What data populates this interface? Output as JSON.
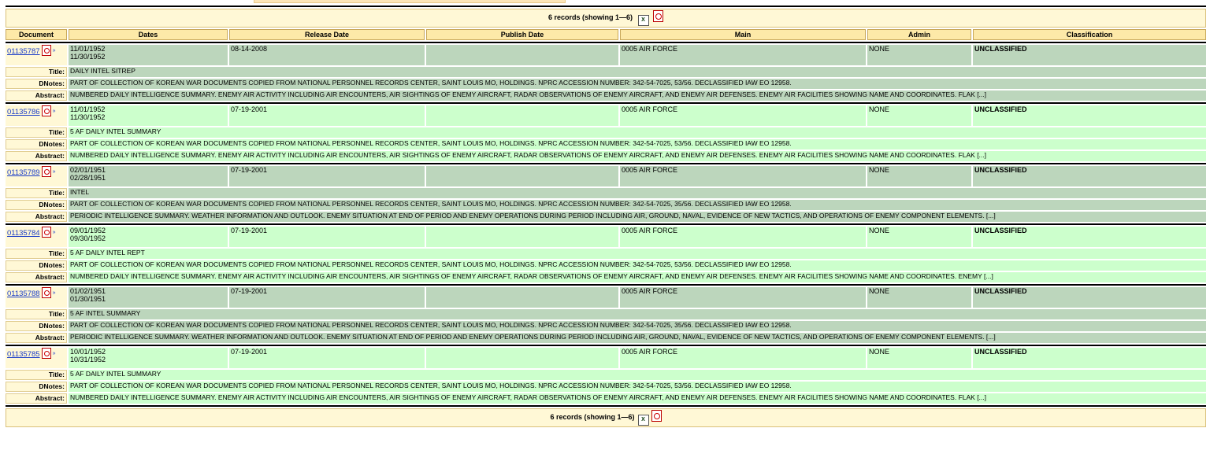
{
  "summary": {
    "text": "6 records (showing 1—6)"
  },
  "headers": [
    "Document",
    "Dates",
    "Release Date",
    "Publish Date",
    "Main",
    "Admin",
    "Classification"
  ],
  "labels": {
    "title": "Title:",
    "dnotes": "DNotes:",
    "abstract": "Abstract:"
  },
  "records": [
    {
      "doc": "01135787",
      "date_from": "11/01/1952",
      "date_to": "11/30/1952",
      "release": "08-14-2008",
      "publish": "",
      "main": "0005 AIR FORCE",
      "admin": "NONE",
      "classification": "UNCLASSIFIED",
      "title": "DAILY INTEL SITREP",
      "dnotes": "PART OF COLLECTION OF KOREAN WAR DOCUMENTS COPIED FROM NATIONAL PERSONNEL RECORDS CENTER, SAINT LOUIS MO, HOLDINGS. NPRC ACCESSION NUMBER: 342-54-7025, 53/56. DECLASSIFIED IAW EO 12958.",
      "abstract": "NUMBERED DAILY INTELLIGENCE SUMMARY. ENEMY AIR ACTIVITY INCLUDING AIR ENCOUNTERS, AIR SIGHTINGS OF ENEMY AIRCRAFT, RADAR OBSERVATIONS OF ENEMY AIRCRAFT, AND ENEMY AIR DEFENSES. ENEMY AIR FACILITIES SHOWING NAME AND COORDINATES. FLAK [...]"
    },
    {
      "doc": "01135786",
      "date_from": "11/01/1952",
      "date_to": "11/30/1952",
      "release": "07-19-2001",
      "publish": "",
      "main": "0005 AIR FORCE",
      "admin": "NONE",
      "classification": "UNCLASSIFIED",
      "title": "5 AF DAILY INTEL SUMMARY",
      "dnotes": "PART OF COLLECTION OF KOREAN WAR DOCUMENTS COPIED FROM NATIONAL PERSONNEL RECORDS CENTER, SAINT LOUIS MO, HOLDINGS. NPRC ACCESSION NUMBER: 342-54-7025, 53/56. DECLASSIFIED IAW EO 12958.",
      "abstract": "NUMBERED DAILY INTELLIGENCE SUMMARY. ENEMY AIR ACTIVITY INCLUDING AIR ENCOUNTERS, AIR SIGHTINGS OF ENEMY AIRCRAFT, RADAR OBSERVATIONS OF ENEMY AIRCRAFT, AND ENEMY AIR DEFENSES. ENEMY AIR FACILITIES SHOWING NAME AND COORDINATES. FLAK [...]"
    },
    {
      "doc": "01135789",
      "date_from": "02/01/1951",
      "date_to": "02/28/1951",
      "release": "07-19-2001",
      "publish": "",
      "main": "0005 AIR FORCE",
      "admin": "NONE",
      "classification": "UNCLASSIFIED",
      "title": "INTEL",
      "dnotes": "PART OF COLLECTION OF KOREAN WAR DOCUMENTS COPIED FROM NATIONAL PERSONNEL RECORDS CENTER, SAINT LOUIS MO, HOLDINGS. NPRC ACCESSION NUMBER: 342-54-7025, 35/56. DECLASSIFIED IAW EO 12958.",
      "abstract": "PERIODIC INTELLIGENCE SUMMARY. WEATHER INFORMATION AND OUTLOOK. ENEMY SITUATION AT END OF PERIOD AND ENEMY OPERATIONS DURING PERIOD INCLUDING AIR, GROUND, NAVAL, EVIDENCE OF NEW TACTICS, AND OPERATIONS OF ENEMY COMPONENT ELEMENTS.  [...]"
    },
    {
      "doc": "01135784",
      "date_from": "09/01/1952",
      "date_to": "09/30/1952",
      "release": "07-19-2001",
      "publish": "",
      "main": "0005 AIR FORCE",
      "admin": "NONE",
      "classification": "UNCLASSIFIED",
      "title": "5 AF DAILY INTEL REPT",
      "dnotes": "PART OF COLLECTION OF KOREAN WAR DOCUMENTS COPIED FROM NATIONAL PERSONNEL RECORDS CENTER, SAINT LOUIS MO, HOLDINGS. NPRC ACCESSION NUMBER: 342-54-7025, 53/56. DECLASSIFIED IAW EO 12958.",
      "abstract": "NUMBERED DAILY INTELLIGENCE SUMMARY. ENEMY AIR ACTIVITY INCLUDING AIR ENCOUNTERS, AIR SIGHTINGS OF ENEMY AIRCRAFT, RADAR OBSERVATIONS OF ENEMY AIRCRAFT, AND ENEMY AIR DEFENSES. ENEMY AIR FACILITIES SHOWING NAME AND COORDINATES. ENEMY [...]"
    },
    {
      "doc": "01135788",
      "date_from": "01/02/1951",
      "date_to": "01/30/1951",
      "release": "07-19-2001",
      "publish": "",
      "main": "0005 AIR FORCE",
      "admin": "NONE",
      "classification": "UNCLASSIFIED",
      "title": "5 AF INTEL SUMMARY",
      "dnotes": "PART OF COLLECTION OF KOREAN WAR DOCUMENTS COPIED FROM NATIONAL PERSONNEL RECORDS CENTER, SAINT LOUIS MO, HOLDINGS. NPRC ACCESSION NUMBER: 342-54-7025, 35/56. DECLASSIFIED IAW EO 12958.",
      "abstract": "PERIODIC INTELLIGENCE SUMMARY. WEATHER INFORMATION AND OUTLOOK. ENEMY SITUATION AT END OF PERIOD AND ENEMY OPERATIONS DURING PERIOD INCLUDING AIR, GROUND, NAVAL, EVIDENCE OF NEW TACTICS, AND OPERATIONS OF ENEMY COMPONENT ELEMENTS.  [...]"
    },
    {
      "doc": "01135785",
      "date_from": "10/01/1952",
      "date_to": "10/31/1952",
      "release": "07-19-2001",
      "publish": "",
      "main": "0005 AIR FORCE",
      "admin": "NONE",
      "classification": "UNCLASSIFIED",
      "title": "5 AF DAILY INTEL SUMMARY",
      "dnotes": "PART OF COLLECTION OF KOREAN WAR DOCUMENTS COPIED FROM NATIONAL PERSONNEL RECORDS CENTER, SAINT LOUIS MO, HOLDINGS. NPRC ACCESSION NUMBER: 342-54-7025, 53/56. DECLASSIFIED IAW EO 12958.",
      "abstract": "NUMBERED DAILY INTELLIGENCE SUMMARY. ENEMY AIR ACTIVITY INCLUDING AIR ENCOUNTERS, AIR SIGHTINGS OF ENEMY AIRCRAFT, RADAR OBSERVATIONS OF ENEMY AIRCRAFT, AND ENEMY AIR DEFENSES. ENEMY AIR FACILITIES SHOWING NAME AND COORDINATES. FLAK [...]"
    }
  ],
  "icons": {
    "pdf": "pdf-icon",
    "cite": "cite-icon",
    "excel": "excel-export-icon"
  },
  "colors": {
    "header_bg": "#fde9a8",
    "odd_row": "#bcd6bc",
    "even_row": "#ccffcc",
    "label_bg": "#fff8d6",
    "link": "#1a3cc8"
  }
}
